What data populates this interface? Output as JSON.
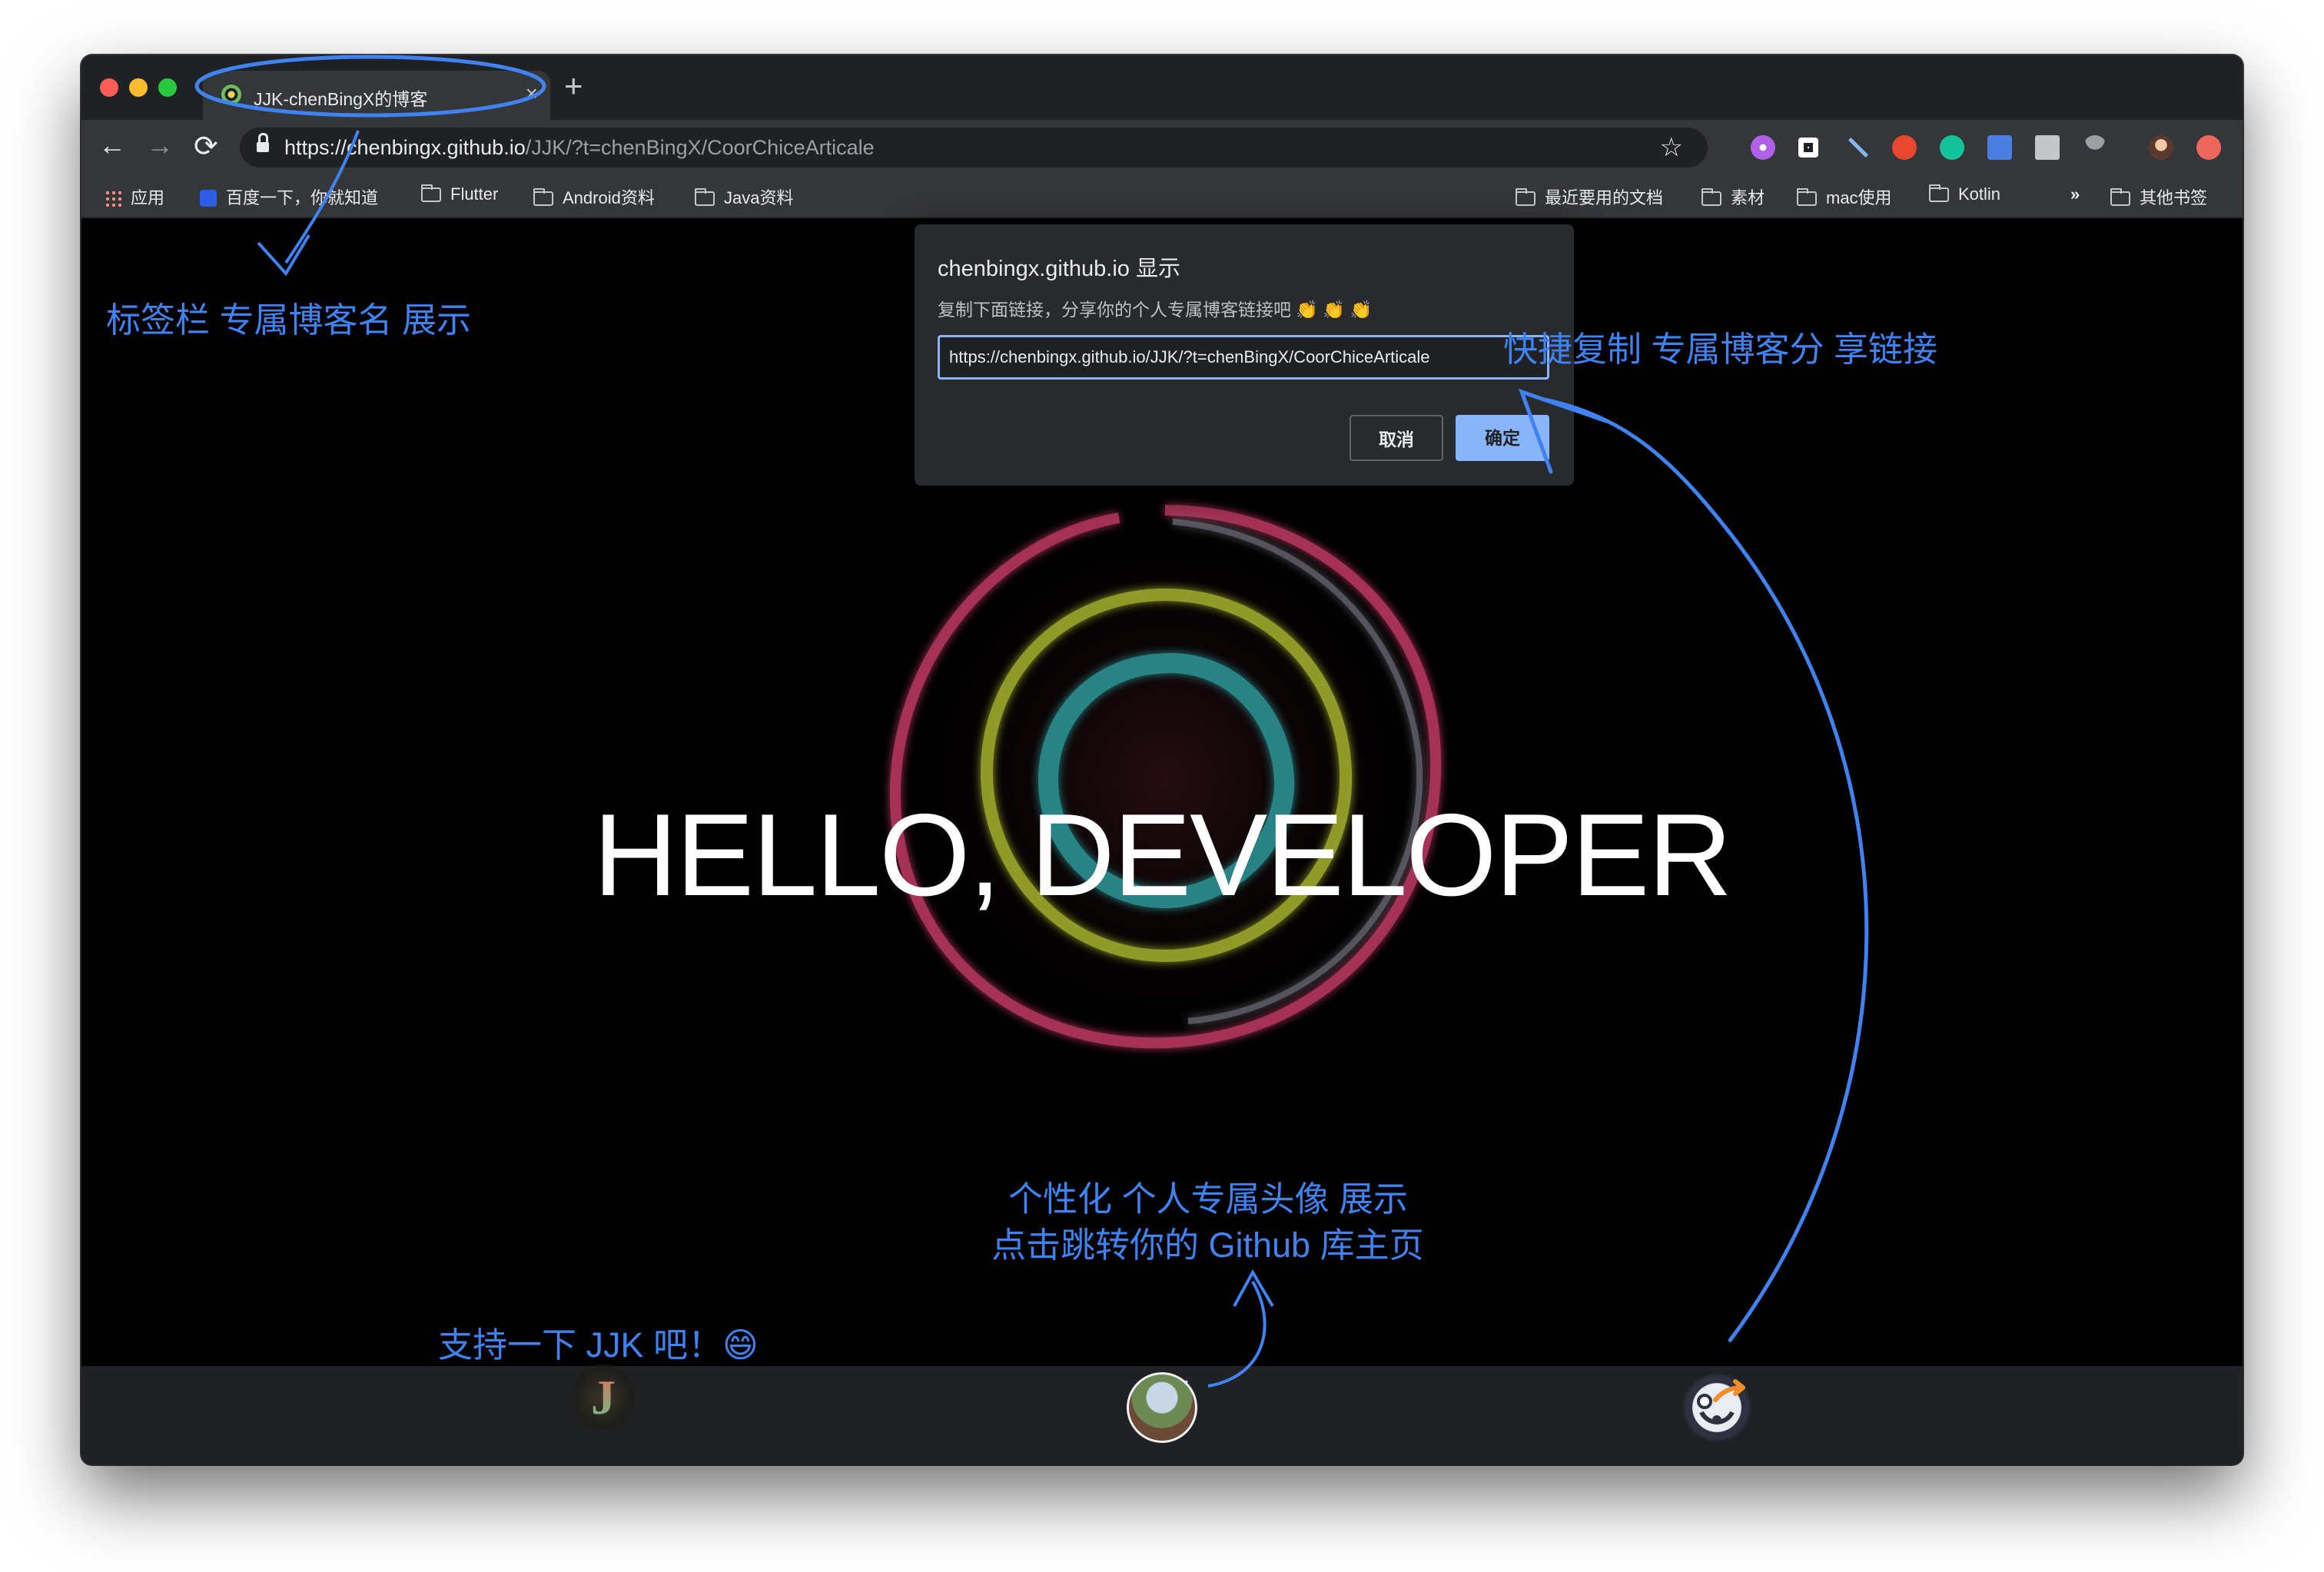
{
  "browser": {
    "tab": {
      "title": "JJK-chenBingX的博客",
      "close": "×"
    },
    "new_tab": "+",
    "nav": {
      "back": "←",
      "forward": "→",
      "reload": "⟳"
    },
    "address": {
      "host": "https://chenbingx.github.io",
      "path": "/JJK/?t=chenBingX/CoorChiceArticale"
    },
    "bookmark_star": "☆",
    "extensions": [
      "purple-circle-extension",
      "square-extension",
      "pen-extension",
      "infinity-extension",
      "grammarly-extension",
      "translate-extension",
      "download-extension",
      "umbrella-extension",
      "profile-avatar",
      "update-extension"
    ],
    "bookmarks": {
      "apps": "应用",
      "baidu": "百度一下，你就知道",
      "items": [
        "Flutter",
        "Android资料",
        "Java资料"
      ],
      "right_items": [
        "最近要用的文档",
        "素材",
        "mac使用",
        "Kotlin"
      ],
      "more": "»",
      "other": "其他书签"
    }
  },
  "dialog": {
    "title": "chenbingx.github.io 显示",
    "message": "复制下面链接，分享你的个人专属博客链接吧 👏 👏 👏",
    "link_value": "https://chenbingx.github.io/JJK/?t=chenBingX/CoorChiceArticale",
    "cancel": "取消",
    "confirm": "确定"
  },
  "hero": {
    "title": "HELLO, DEVELOPER"
  },
  "footer": {
    "logo_letter": "J",
    "scroll_hint": "⌄⌄"
  },
  "annotations": {
    "tab_note": "标签栏 专属博客名 展示",
    "share_note": "快捷复制 专属博客分 享链接",
    "avatar_note_line1": "个性化 个人专属头像 展示",
    "avatar_note_line2": "点击跳转你的 Github 库主页",
    "support_note": "支持一下 JJK 吧！😄"
  },
  "colors": {
    "annotation": "#3f82f0",
    "dialog_bg": "#292a2d",
    "confirm_bg": "#8ab4f8"
  }
}
